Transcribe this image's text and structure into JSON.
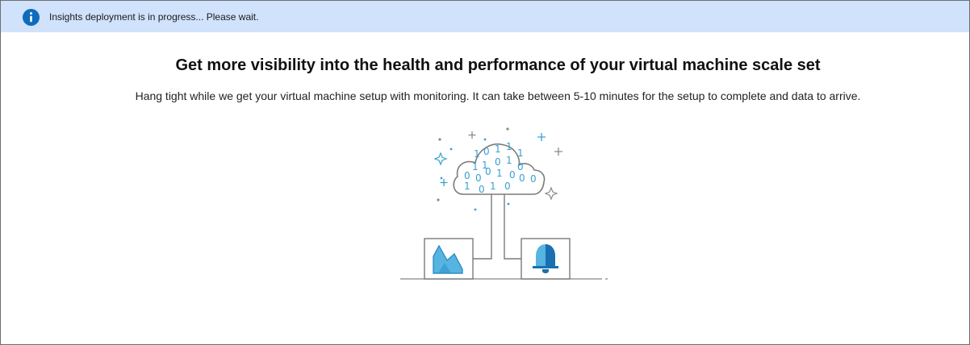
{
  "notification": {
    "icon": "info-icon",
    "message": "Insights deployment is in progress... Please wait.",
    "color": "#d0e2fc",
    "icon_color": "#0f6cbd"
  },
  "main": {
    "title": "Get more visibility into the health and performance of your virtual machine scale set",
    "description": "Hang tight while we get your virtual machine setup with monitoring. It can take between 5-10 minutes for the setup to complete and data to arrive."
  },
  "illustration": {
    "cloud_icon": "binary-cloud-icon",
    "left_box_icon": "area-chart-icon",
    "right_box_icon": "bell-alert-icon",
    "binary_digits": [
      "1",
      "0",
      "1",
      "1",
      "1",
      "0",
      "1",
      "0",
      "0",
      "1",
      "1",
      "0",
      "0",
      "1",
      "0",
      "1",
      "0",
      "0",
      "0",
      "1",
      "1"
    ],
    "accent_color": "#3aa0d0"
  }
}
